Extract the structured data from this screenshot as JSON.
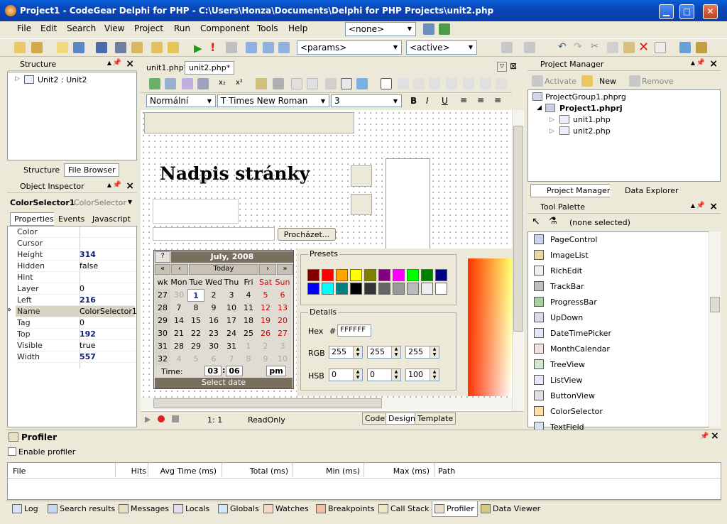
{
  "window": {
    "title": "Project1 - CodeGear Delphi for PHP - C:\\Users\\Honza\\Documents\\Delphi for PHP Projects\\unit2.php",
    "min": "▁",
    "max": "□",
    "close": "✕"
  },
  "menu": [
    "File",
    "Edit",
    "Search",
    "View",
    "Project",
    "Run",
    "Component",
    "Tools",
    "Help"
  ],
  "toolbar": {
    "config_combo": "<none>",
    "params_combo": "<params>",
    "active_combo": "<active>"
  },
  "structure": {
    "title": "Structure",
    "tree_item": "Unit2 : Unit2",
    "tab_structure": "Structure",
    "tab_file_browser": "File Browser"
  },
  "object_inspector": {
    "title": "Object Inspector",
    "component_name": "ColorSelector1",
    "component_type": "ColorSelector",
    "tabs": [
      "Properties",
      "Events",
      "Javascript"
    ],
    "rows": [
      {
        "k": "Color",
        "v": ""
      },
      {
        "k": "Cursor",
        "v": ""
      },
      {
        "k": "Height",
        "v": "314"
      },
      {
        "k": "Hidden",
        "v": "false"
      },
      {
        "k": "Hint",
        "v": ""
      },
      {
        "k": "Layer",
        "v": "0"
      },
      {
        "k": "Left",
        "v": "216"
      },
      {
        "k": "Name",
        "v": "ColorSelector1"
      },
      {
        "k": "Tag",
        "v": "0"
      },
      {
        "k": "Top",
        "v": "192"
      },
      {
        "k": "Visible",
        "v": "true"
      },
      {
        "k": "Width",
        "v": "557"
      }
    ]
  },
  "editor": {
    "tabs": [
      "unit1.php*",
      "unit2.php*"
    ],
    "style_combo": "Normální",
    "font_combo": "Times New Roman",
    "size_combo": "3",
    "heading": "Nadpis stránky",
    "browse_button": "Procházet...",
    "status_pos": "1:  1",
    "status_mode": "ReadOnly",
    "view_tabs": [
      "Code",
      "Design",
      "Template"
    ]
  },
  "calendar": {
    "month": "July, 2008",
    "help": "?",
    "prev_year": "«",
    "prev_month": "‹",
    "today": "Today",
    "next_month": "›",
    "next_year": "»",
    "headers": [
      "wk",
      "Mon",
      "Tue",
      "Wed",
      "Thu",
      "Fri",
      "Sat",
      "Sun"
    ],
    "rows": [
      [
        "27",
        "30",
        "1",
        "2",
        "3",
        "4",
        "5",
        "6"
      ],
      [
        "28",
        "7",
        "8",
        "9",
        "10",
        "11",
        "12",
        "13"
      ],
      [
        "29",
        "14",
        "15",
        "16",
        "17",
        "18",
        "19",
        "20"
      ],
      [
        "30",
        "21",
        "22",
        "23",
        "24",
        "25",
        "26",
        "27"
      ],
      [
        "31",
        "28",
        "29",
        "30",
        "31",
        "1",
        "2",
        "3"
      ],
      [
        "32",
        "4",
        "5",
        "6",
        "7",
        "8",
        "9",
        "10"
      ]
    ],
    "time_label": "Time:",
    "hour": "03",
    "minute": "06",
    "ampm": "pm",
    "select": "Select date"
  },
  "color_selector": {
    "presets_label": "Presets",
    "details_label": "Details",
    "hex_label": "Hex",
    "hash": "#",
    "hex_value": "FFFFFF",
    "rgb_label": "RGB",
    "hsb_label": "HSB",
    "rgb": [
      "255",
      "255",
      "255"
    ],
    "hsb": [
      "0",
      "0",
      "100"
    ],
    "swatches": [
      "#800000",
      "#ff0000",
      "#ffa500",
      "#ffff00",
      "#808000",
      "#800080",
      "#ff00ff",
      "#00ff00",
      "#008000",
      "#000080",
      "#0000ff",
      "#00ffff",
      "#008080",
      "#000000",
      "#333333",
      "#666666",
      "#999999",
      "#bbbbbb",
      "#eeeeee",
      "#ffffff"
    ]
  },
  "project_manager": {
    "title": "Project Manager",
    "activate": "Activate",
    "new": "New",
    "remove": "Remove",
    "group": "ProjectGroup1.phprg",
    "project": "Project1.phprj",
    "files": [
      "unit1.php",
      "unit2.php"
    ],
    "tab_pm": "Project Manager",
    "tab_de": "Data Explorer"
  },
  "tool_palette": {
    "title": "Tool Palette",
    "selection": "(none selected)",
    "items": [
      "PageControl",
      "ImageList",
      "RichEdit",
      "TrackBar",
      "ProgressBar",
      "UpDown",
      "DateTimePicker",
      "MonthCalendar",
      "TreeView",
      "ListView",
      "ButtonView",
      "ColorSelector",
      "TextField"
    ]
  },
  "profiler": {
    "title": "Profiler",
    "enable": "Enable profiler",
    "columns": [
      "File",
      "Hits",
      "Avg Time (ms)",
      "Total (ms)",
      "Min (ms)",
      "Max (ms)",
      "Path"
    ]
  },
  "bottom_tabs": [
    "Log",
    "Search results",
    "Messages",
    "Locals",
    "Globals",
    "Watches",
    "Breakpoints",
    "Call Stack",
    "Profiler",
    "Data Viewer"
  ]
}
